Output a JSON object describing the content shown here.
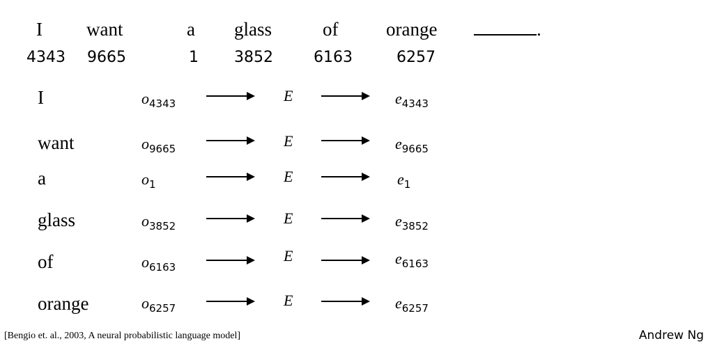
{
  "sentence": {
    "words": [
      "I",
      "want",
      "a",
      "glass",
      "of",
      "orange"
    ],
    "blank_trailer": "."
  },
  "indices": [
    "4343",
    "9665",
    "1",
    "3852",
    "6163",
    "6257"
  ],
  "rows": [
    {
      "word": "I",
      "onehot": "o",
      "sub": "4343",
      "matrix": "E",
      "embed": "e",
      "embed_sub": "4343"
    },
    {
      "word": "want",
      "onehot": "o",
      "sub": "9665",
      "matrix": "E",
      "embed": "e",
      "embed_sub": "9665"
    },
    {
      "word": "a",
      "onehot": "o",
      "sub": "1",
      "matrix": "E",
      "embed": "e",
      "embed_sub": "1"
    },
    {
      "word": "glass",
      "onehot": "o",
      "sub": "3852",
      "matrix": "E",
      "embed": "e",
      "embed_sub": "3852"
    },
    {
      "word": "of",
      "onehot": "o",
      "sub": "6163",
      "matrix": "E",
      "embed": "e",
      "embed_sub": "6163"
    },
    {
      "word": "orange",
      "onehot": "o",
      "sub": "6257",
      "matrix": "E",
      "embed": "e",
      "embed_sub": "6257"
    }
  ],
  "footer": {
    "citation": "[Bengio et. al., 2003, A neural probabilistic language model]",
    "author": "Andrew Ng"
  }
}
